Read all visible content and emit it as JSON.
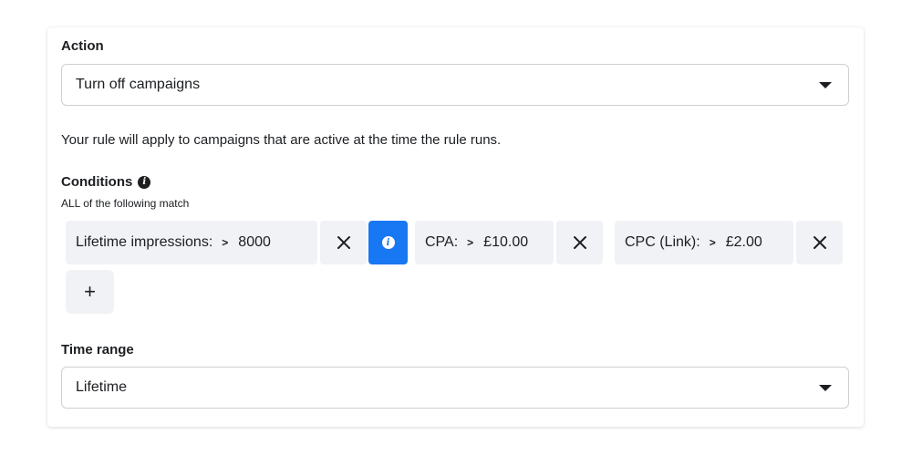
{
  "action": {
    "label": "Action",
    "selected": "Turn off campaigns"
  },
  "note": "Your rule will apply to campaigns that are active at the time the rule runs.",
  "conditions": {
    "title": "Conditions",
    "subtitle": "ALL of the following match",
    "items": [
      {
        "metric": "Lifetime impressions:",
        "operator": ">",
        "value": "8000"
      },
      {
        "metric": "CPA:",
        "operator": ">",
        "value": "£10.00"
      },
      {
        "metric": "CPC (Link):",
        "operator": ">",
        "value": "£2.00"
      }
    ],
    "add_label": "+"
  },
  "time_range": {
    "label": "Time range",
    "selected": "Lifetime"
  },
  "colors": {
    "accent": "#1877f2",
    "chip_bg": "#f0f2f5",
    "text": "#1c1e21",
    "border": "#ccd0d5"
  },
  "icons": {
    "info": "info-icon",
    "remove": "close-icon",
    "dropdown": "caret-down-icon",
    "add": "plus-icon"
  }
}
